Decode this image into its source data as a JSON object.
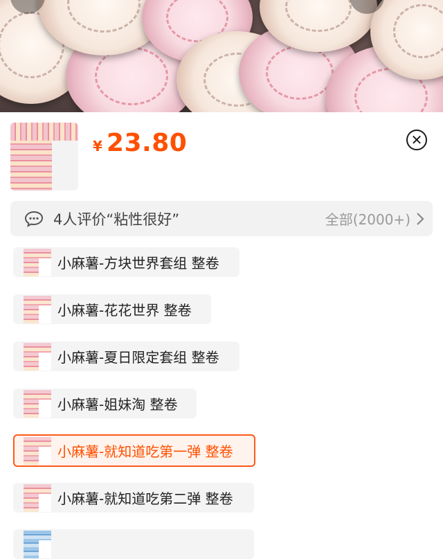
{
  "header_image": {
    "icon": "product-photo-washi-tape-rolls"
  },
  "sku_panel": {
    "currency": "¥",
    "price": "23.80",
    "close_icon": "close-circle-icon"
  },
  "reviews": {
    "icon": "chat-bubble-icon",
    "summary": "4人评价“粘性很好”",
    "all_label": "全部(2000+)",
    "chevron": "chevron-right-icon"
  },
  "options": [
    {
      "label": "小麻薯-方块世界套组 整卷",
      "selected": false
    },
    {
      "label": "小麻薯-花花世界 整卷",
      "selected": false
    },
    {
      "label": "小麻薯-夏日限定套组 整卷",
      "selected": false
    },
    {
      "label": "小麻薯-姐妹淘 整卷",
      "selected": false
    },
    {
      "label": "小麻薯-就知道吃第一弹 整卷",
      "selected": true
    },
    {
      "label": "小麻薯-就知道吃第二弹 整卷",
      "selected": false
    }
  ],
  "colors": {
    "accent": "#ff5000",
    "selected_border": "#ff5a1a",
    "option_bg": "#f4f4f4"
  }
}
